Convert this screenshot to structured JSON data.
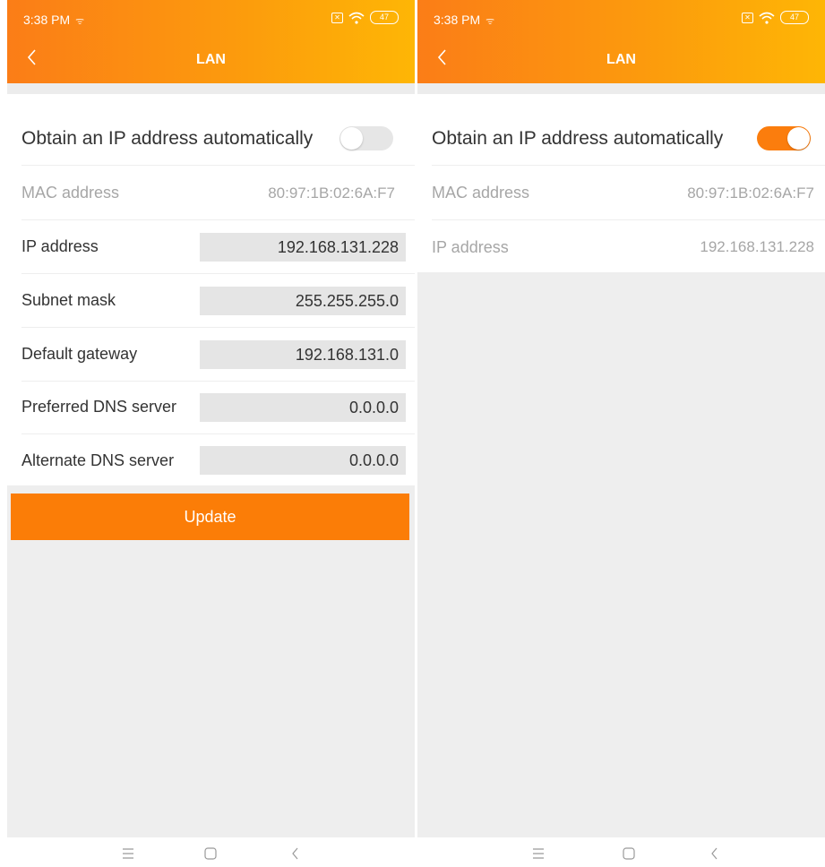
{
  "status_bar": {
    "time": "3:38 PM",
    "battery": "47"
  },
  "header": {
    "title": "LAN"
  },
  "left_screen": {
    "toggle_label": "Obtain an IP address automatically",
    "toggle_on": false,
    "mac_label": "MAC address",
    "mac_value": "80:97:1B:02:6A:F7",
    "fields": [
      {
        "label": "IP address",
        "value": "192.168.131.228"
      },
      {
        "label": "Subnet mask",
        "value": "255.255.255.0"
      },
      {
        "label": "Default gateway",
        "value": "192.168.131.0"
      },
      {
        "label": "Preferred DNS server",
        "value": "0.0.0.0"
      },
      {
        "label": "Alternate DNS server",
        "value": "0.0.0.0"
      }
    ],
    "update_label": "Update"
  },
  "right_screen": {
    "toggle_label": "Obtain an IP address automatically",
    "toggle_on": true,
    "mac_label": "MAC address",
    "mac_value": "80:97:1B:02:6A:F7",
    "ip_label": "IP address",
    "ip_value": "192.168.131.228"
  },
  "colors": {
    "accent": "#fb7d0d",
    "header_gradient_start": "#fb7d17",
    "header_gradient_end": "#feb605"
  },
  "icons": [
    "back-icon",
    "wifi-icon",
    "sim-icon",
    "battery-icon",
    "menu-icon",
    "home-icon",
    "nav-back-icon"
  ]
}
